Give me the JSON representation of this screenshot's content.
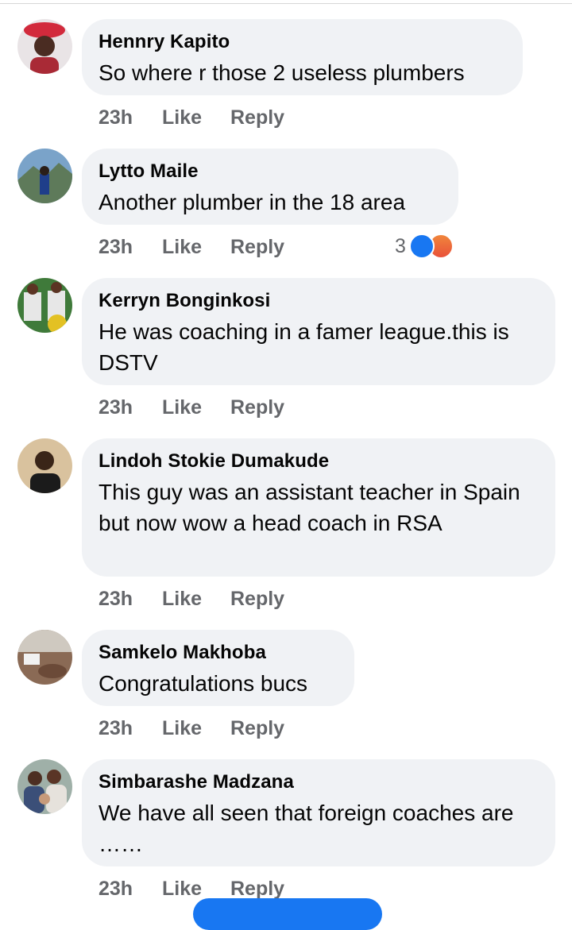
{
  "comments": [
    {
      "name": "Hennry Kapito",
      "text": "So where r those 2 useless plumbers",
      "time": "23h",
      "like": "Like",
      "reply": "Reply"
    },
    {
      "name": "Lytto Maile",
      "text": "Another plumber in the 18 area",
      "time": "23h",
      "like": "Like",
      "reply": "Reply",
      "reactions": {
        "count": "3",
        "icons": [
          "like-icon",
          "angry-icon"
        ]
      }
    },
    {
      "name": "Kerryn Bonginkosi",
      "text": "He was coaching in a famer league.this is DSTV",
      "time": "23h",
      "like": "Like",
      "reply": "Reply"
    },
    {
      "name": "Lindoh Stokie Dumakude",
      "text": "This guy was an assistant teacher in Spain but now wow a head coach in RSA",
      "time": "23h",
      "like": "Like",
      "reply": "Reply"
    },
    {
      "name": "Samkelo Makhoba",
      "text": "Congratulations bucs",
      "time": "23h",
      "like": "Like",
      "reply": "Reply"
    },
    {
      "name": "Simbarashe Madzana",
      "text": "We have all seen that foreign coaches are ……",
      "time": "23h",
      "like": "Like",
      "reply": "Reply"
    }
  ],
  "colors": {
    "bubble": "#f0f2f5",
    "meta": "#65676b",
    "accent": "#1877f2"
  }
}
